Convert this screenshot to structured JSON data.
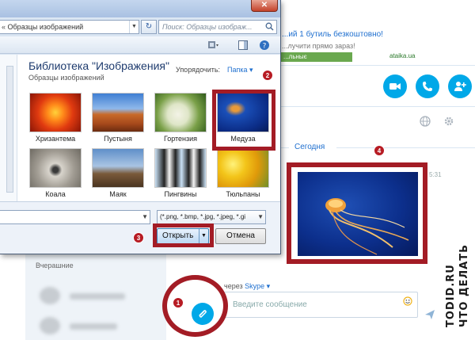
{
  "skype": {
    "ad_title": "...ий 1 бутиль безкоштовно!",
    "ad_subtitle": "...лучити прямо зараз!",
    "ad_button": "...льныє",
    "ad_domain": "ataika.ua",
    "today_label": "Сегодня",
    "time_label": "5:31",
    "yesterday_label": "Вчерашние",
    "via_prefix": "через",
    "via_service": "Skype ▾",
    "message_placeholder": "Введите сообщение"
  },
  "dialog": {
    "address_chevron": "«",
    "address_path": "Образцы изображений",
    "search_placeholder": "Поиск: Образцы изображ...",
    "close_label": "✕",
    "library_title": "Библиотека \"Изображения\"",
    "library_subtitle": "Образцы изображений",
    "arrange_label": "Упорядочить:",
    "arrange_value": "Папка ▾",
    "thumbnails": [
      {
        "caption": "Хризантема"
      },
      {
        "caption": "Пустыня"
      },
      {
        "caption": "Гортензия"
      },
      {
        "caption": "Медуза"
      },
      {
        "caption": "Коала"
      },
      {
        "caption": "Маяк"
      },
      {
        "caption": "Пингвины"
      },
      {
        "caption": "Тюльпаны"
      }
    ],
    "file_type": "(*.png, *.bmp, *.jpg, *.jpeg, *.gi",
    "open_label": "Открыть",
    "cancel_label": "Отмена"
  },
  "markers": {
    "m1": "1",
    "m2": "2",
    "m3": "3",
    "m4": "4"
  },
  "watermark": {
    "line1": "TODID.RU",
    "line2": "ЧТО ДЕЛАТЬ"
  },
  "colors": {
    "skype_blue": "#00a8e8",
    "annotation_red": "#a31c25",
    "dialog_bg": "#dbe6f3"
  }
}
